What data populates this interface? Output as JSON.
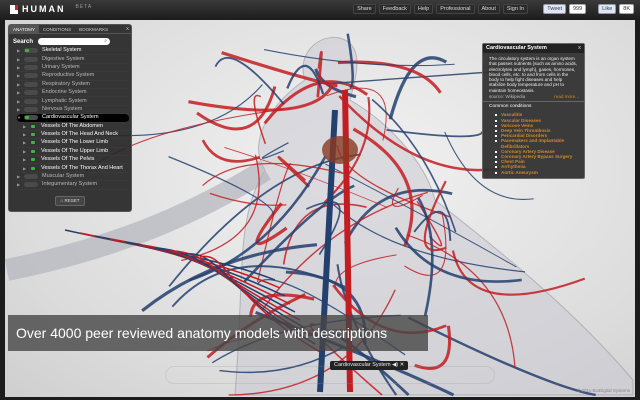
{
  "header": {
    "logo": "HUMAN",
    "beta": "BETA",
    "nav": [
      "Share",
      "Feedback",
      "Help",
      "Professional",
      "About",
      "Sign In"
    ],
    "tweet": "Tweet",
    "tweet_count": "999",
    "like": "Like",
    "like_count": "8K"
  },
  "panel": {
    "tabs": [
      "Anatomy",
      "Conditions",
      "Bookmarks"
    ],
    "close": "x",
    "search_label": "Search",
    "search_placeholder": "",
    "systems": [
      {
        "label": "Skeletal System",
        "on": true
      },
      {
        "label": "Digestive System",
        "on": false
      },
      {
        "label": "Urinary System",
        "on": false
      },
      {
        "label": "Reproductive System",
        "on": false
      },
      {
        "label": "Respiratory System",
        "on": false
      },
      {
        "label": "Endocrine System",
        "on": false
      },
      {
        "label": "Lymphatic System",
        "on": false
      },
      {
        "label": "Nervous System",
        "on": false
      },
      {
        "label": "Cardiovascular System",
        "on": true,
        "selected": true
      },
      {
        "label": "Vessels Of The Abdomen",
        "sub": true
      },
      {
        "label": "Vessels Of The Head And Neck",
        "sub": true
      },
      {
        "label": "Vessels Of The Lower Limb",
        "sub": true
      },
      {
        "label": "Vessels Of The Upper Limb",
        "sub": true
      },
      {
        "label": "Vessels Of The Pelvis",
        "sub": true
      },
      {
        "label": "Vessels Of The Thorax And Heart",
        "sub": true
      },
      {
        "label": "Muscular System",
        "on": false
      },
      {
        "label": "Integumentary System",
        "on": false
      }
    ],
    "reset": "RESET"
  },
  "info": {
    "title": "Cardiovascular System",
    "close": "x",
    "description": "The circulatory system is an organ system that passes nutrients (such as amino acids, electrolytes and lymph), gases, hormones, blood cells, etc. to and from cells in the body to help fight diseases and help stabilize body temperature and pH to maintain homeostasis.",
    "source": "source: Wikipedia",
    "read_more": "read more...",
    "conditions_title": "Common conditions",
    "conditions": [
      "Vasculitis",
      "Vascular Diseases",
      "Varicose Veins",
      "Deep Vein Thrombosis",
      "Pericardial Disorders",
      "Pacemakers and Implantable Defibrillators",
      "Coronary Artery Disease",
      "Coronary Artery Bypass Surgery",
      "Chest Pain",
      "Arrhythmia",
      "Aortic Aneurysm"
    ]
  },
  "caption": "Over 4000 peer reviewed anatomy models with descriptions",
  "selection": "Cardiovascular System",
  "copyright": "© 2011 BioDigital Systems",
  "colors": {
    "artery": "#c21d22",
    "vein": "#23406e",
    "accent": "#d18a2a",
    "toggle_on": "#3eb53e"
  }
}
